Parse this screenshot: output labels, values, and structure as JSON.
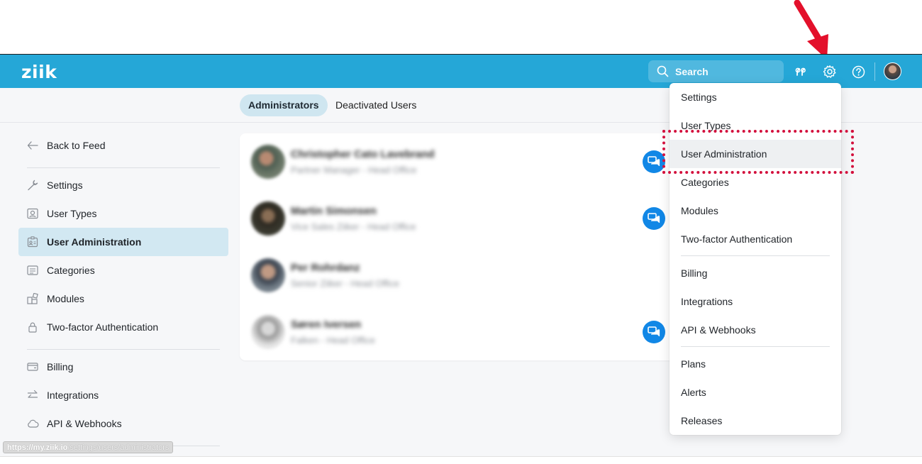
{
  "app": {
    "logo_text": "ziik",
    "brand_color": "#25a7d7"
  },
  "topbar": {
    "search": {
      "placeholder": "Search",
      "value": "",
      "icon": "search-icon"
    },
    "icons": [
      "quote-icon",
      "gear-icon",
      "help-icon",
      "avatar"
    ]
  },
  "tabs": [
    {
      "label": "Administrators",
      "active": true
    },
    {
      "label": "Deactivated Users",
      "active": false
    }
  ],
  "sidebar": {
    "items": [
      {
        "label": "Back to Feed",
        "icon": "back-arrow-icon"
      },
      {
        "label": "Settings",
        "icon": "wrench-icon"
      },
      {
        "label": "User Types",
        "icon": "user-card-icon"
      },
      {
        "label": "User Administration",
        "icon": "id-badge-icon",
        "active": true
      },
      {
        "label": "Categories",
        "icon": "categories-icon"
      },
      {
        "label": "Modules",
        "icon": "modules-icon"
      },
      {
        "label": "Two-factor Authentication",
        "icon": "lock-icon"
      },
      {
        "label": "Billing",
        "icon": "wallet-icon"
      },
      {
        "label": "Integrations",
        "icon": "arrows-exchange-icon"
      },
      {
        "label": "API & Webhooks",
        "icon": "cloud-icon"
      }
    ]
  },
  "administrators": [
    {
      "name": "Christopher Cato Lavebrand",
      "role": "Partner Manager - Head Office",
      "has_chat": true
    },
    {
      "name": "Martin Simonsen",
      "role": "Vice Sales Ziiker - Head Office",
      "has_chat": true
    },
    {
      "name": "Per Rohrdanz",
      "role": "Senior Ziiker - Head Office",
      "has_chat": false
    },
    {
      "name": "Søren Iversen",
      "role": "Falken - Head Office",
      "has_chat": true
    }
  ],
  "settings_menu": {
    "items": [
      {
        "label": "Settings"
      },
      {
        "label": "User Types"
      },
      {
        "label": "User Administration",
        "hovered": true
      },
      {
        "label": "Categories"
      },
      {
        "label": "Modules"
      },
      {
        "label": "Two-factor Authentication"
      },
      {
        "label": "Billing"
      },
      {
        "label": "Integrations"
      },
      {
        "label": "API & Webhooks"
      },
      {
        "label": "Plans"
      },
      {
        "label": "Alerts"
      },
      {
        "label": "Releases"
      }
    ]
  },
  "annotation": {
    "color": "#d3103d"
  },
  "status_bar": {
    "url_host": "https://my.ziik.io",
    "url_path": "/settings/users/administrators"
  }
}
